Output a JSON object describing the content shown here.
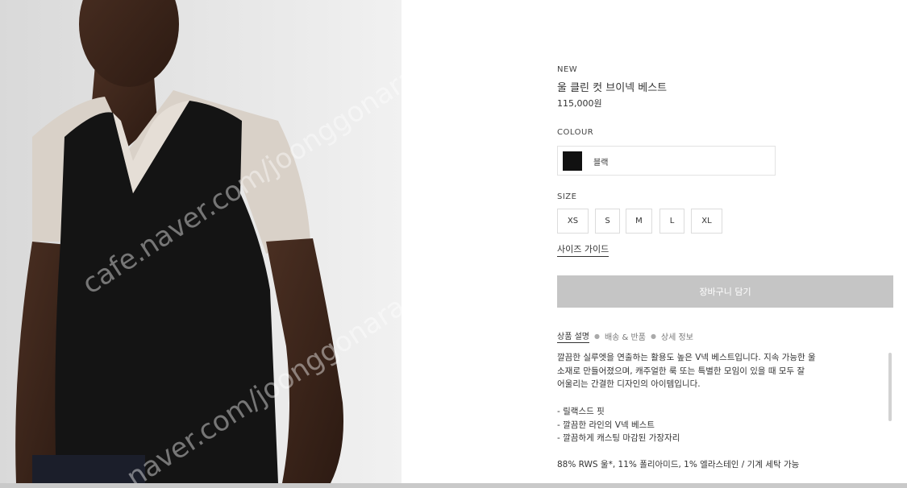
{
  "product": {
    "tag": "NEW",
    "title": "울 클린 컷 브이넥 베스트",
    "price": "115,000원"
  },
  "colour": {
    "label": "COLOUR",
    "selected": "블랙",
    "swatch_color": "#111111"
  },
  "size": {
    "label": "SIZE",
    "options": [
      "XS",
      "S",
      "M",
      "L",
      "XL"
    ],
    "guide_label": "사이즈 가이드"
  },
  "cart": {
    "button_label": "장바구니 담기",
    "button_color": "#c5c5c5"
  },
  "tabs": [
    "상품 설명",
    "배송 & 반품",
    "상세 정보"
  ],
  "description": {
    "lines": [
      "깔끔한 실루엣을 연출하는 활용도 높은 V넥 베스트입니다. 지속 가능한 울",
      "소재로 만들어졌으며, 캐주얼한 룩 또는 특별한 모임이 있을 때 모두 잘",
      "어울리는 간결한 디자인의 아이템입니다."
    ],
    "bullets": [
      "- 릴랙스드 핏",
      "- 깔끔한 라인의 V넥 베스트",
      "- 깔끔하게 캐스팅 마감된 가장자리"
    ],
    "material": "88% RWS 울*, 11% 폴리아미드, 1% 엘라스테인 / 기계 세탁 가능"
  },
  "watermark": {
    "text1": "cafe.naver.com/joonggonara",
    "text2": "naver.com/joonggonara"
  }
}
